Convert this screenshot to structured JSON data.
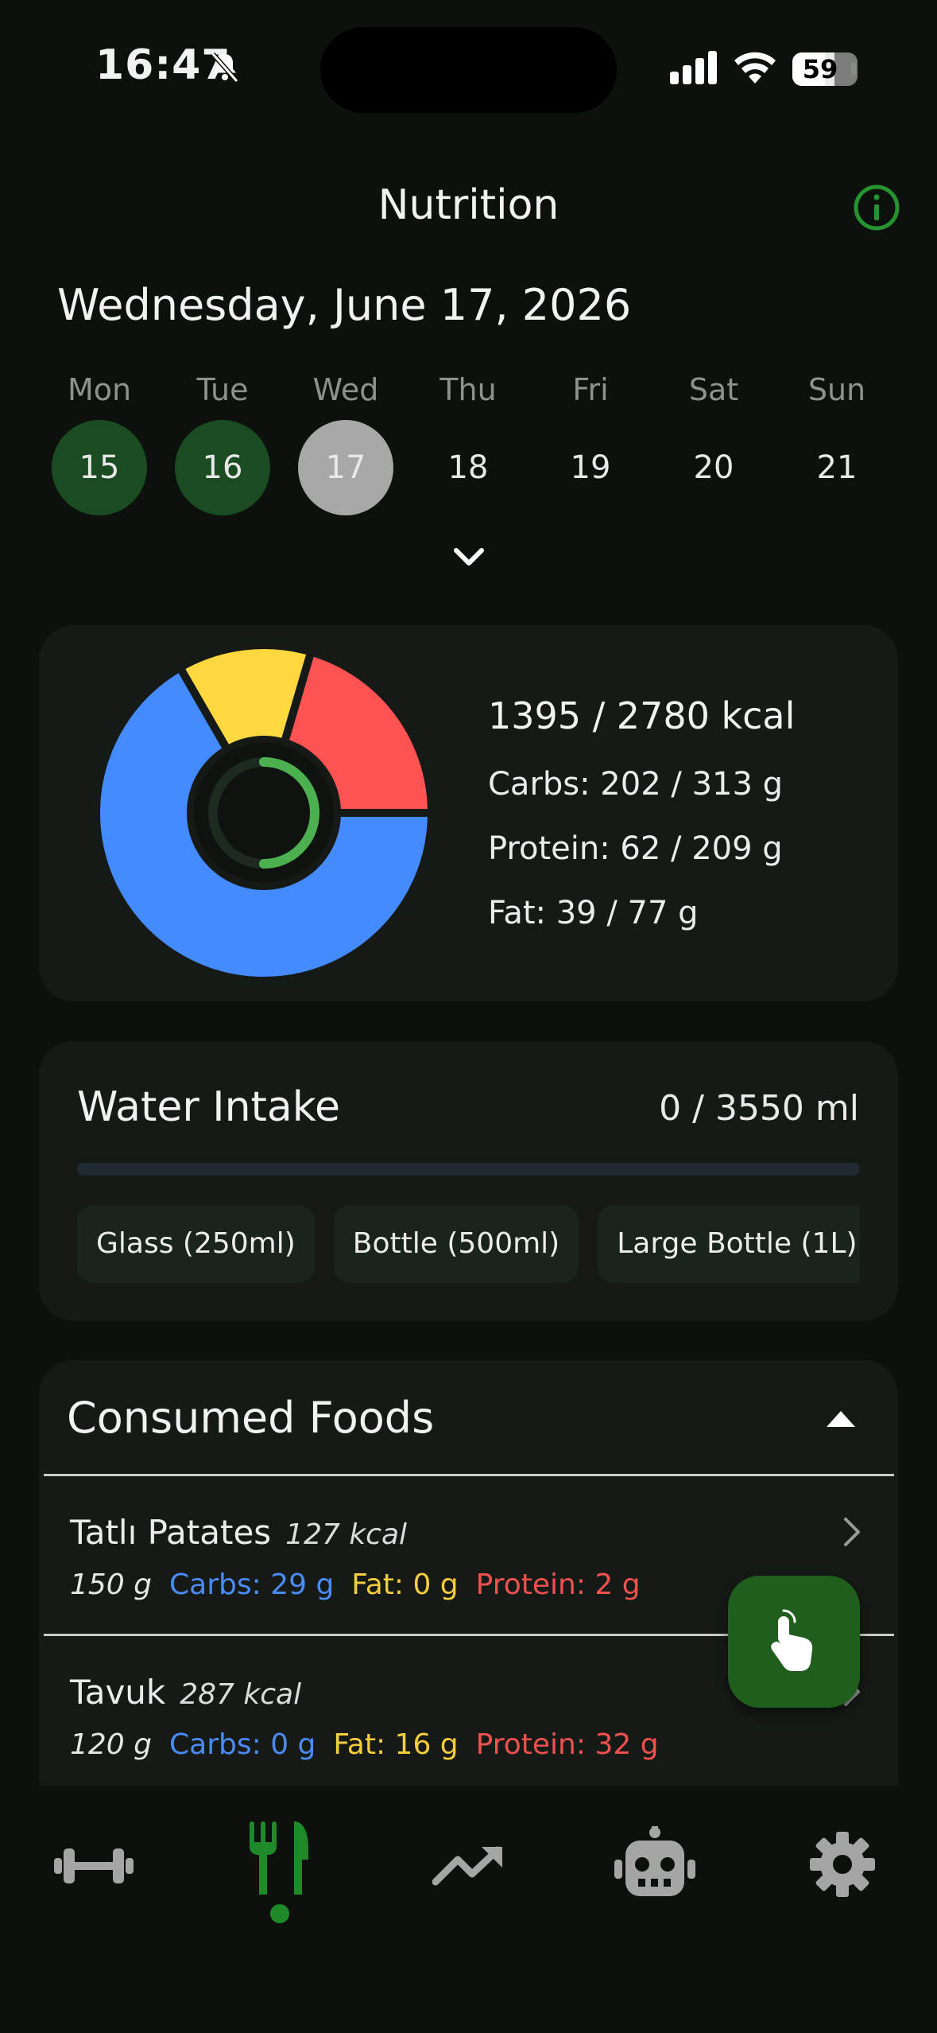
{
  "status_bar": {
    "time": "16:47",
    "battery": "59",
    "battery_level": 0.59
  },
  "header": {
    "title": "Nutrition"
  },
  "date_title": "Wednesday, June 17, 2026",
  "week": [
    {
      "label": "Mon",
      "day": "15",
      "state": "done"
    },
    {
      "label": "Tue",
      "day": "16",
      "state": "done"
    },
    {
      "label": "Wed",
      "day": "17",
      "state": "today"
    },
    {
      "label": "Thu",
      "day": "18",
      "state": "none"
    },
    {
      "label": "Fri",
      "day": "19",
      "state": "none"
    },
    {
      "label": "Sat",
      "day": "20",
      "state": "none"
    },
    {
      "label": "Sun",
      "day": "21",
      "state": "none"
    }
  ],
  "macros": {
    "kcal_text": "1395 / 2780 kcal",
    "carbs_text": "Carbs: 202 / 313 g",
    "protein_text": "Protein: 62 / 209 g",
    "fat_text": "Fat: 39 / 77 g",
    "kcal_progress": 0.5,
    "slices": [
      {
        "name": "carbs",
        "value": 202,
        "color": "#438bff"
      },
      {
        "name": "fat",
        "value": 39,
        "color": "#ffd840"
      },
      {
        "name": "protein",
        "value": 62,
        "color": "#ff5252"
      }
    ],
    "ring_color": "#4caf50"
  },
  "water": {
    "title": "Water Intake",
    "amount_text": "0 / 3550 ml",
    "progress": 0,
    "options": [
      "Glass (250ml)",
      "Bottle (500ml)",
      "Large Bottle (1L)"
    ]
  },
  "foods": {
    "title": "Consumed Foods",
    "items": [
      {
        "name": "Tatlı Patates",
        "kcal": "127 kcal",
        "weight": "150 g",
        "carbs": "Carbs: 29 g",
        "fat": "Fat: 0 g",
        "protein": "Protein: 2 g"
      },
      {
        "name": "Tavuk",
        "kcal": "287 kcal",
        "weight": "120 g",
        "carbs": "Carbs: 0 g",
        "fat": "Fat: 16 g",
        "protein": "Protein: 32 g"
      }
    ]
  },
  "tabs": [
    {
      "icon": "dumbbell-icon",
      "active": false
    },
    {
      "icon": "fork-knife-icon",
      "active": true
    },
    {
      "icon": "trending-up-icon",
      "active": false
    },
    {
      "icon": "robot-icon",
      "active": false
    },
    {
      "icon": "gear-icon",
      "active": false
    }
  ],
  "colors": {
    "accent": "#1e8a2a",
    "done_day": "#1b4b20",
    "today_day": "#a8a8a8"
  }
}
